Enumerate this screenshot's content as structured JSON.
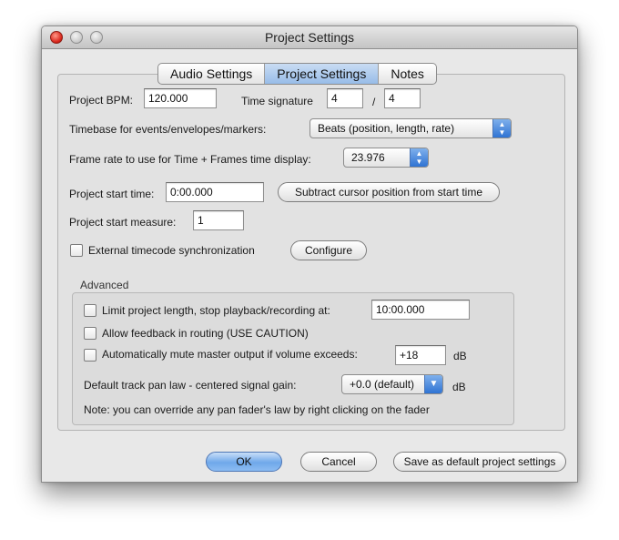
{
  "window": {
    "title": "Project Settings"
  },
  "tabs": [
    {
      "label": "Audio Settings"
    },
    {
      "label": "Project Settings"
    },
    {
      "label": "Notes"
    }
  ],
  "project": {
    "bpm_label": "Project BPM:",
    "bpm_value": "120.000",
    "timesig_label": "Time signature",
    "timesig_num": "4",
    "timesig_sep": "/",
    "timesig_den": "4",
    "timebase_label": "Timebase for events/envelopes/markers:",
    "timebase_value": "Beats (position, length, rate)",
    "framerate_label": "Frame rate to use for Time + Frames time display:",
    "framerate_value": "23.976",
    "start_time_label": "Project start time:",
    "start_time_value": "0:00.000",
    "subtract_button": "Subtract cursor position from start time",
    "start_measure_label": "Project start measure:",
    "start_measure_value": "1",
    "ext_timecode_label": "External timecode synchronization",
    "configure_button": "Configure"
  },
  "advanced": {
    "legend": "Advanced",
    "limit_label": "Limit project length, stop playback/recording at:",
    "limit_value": "10:00.000",
    "feedback_label": "Allow feedback in routing (USE CAUTION)",
    "automute_label": "Automatically mute master output if volume exceeds:",
    "automute_value": "+18",
    "automute_unit": "dB",
    "panlaw_label": "Default track pan law - centered signal gain:",
    "panlaw_value": "+0.0 (default)",
    "panlaw_unit": "dB",
    "note": "Note: you can override any pan fader's law by right clicking on the fader"
  },
  "footer": {
    "ok": "OK",
    "cancel": "Cancel",
    "save_default": "Save as default project settings"
  },
  "colors": {
    "accent": "#6fa8ea",
    "tab_active": "#97bce8",
    "close_light": "#d9261c"
  },
  "icons": {
    "select_arrows": "up-down-arrows-icon",
    "dropdown_arrow": "chevron-down-icon"
  }
}
